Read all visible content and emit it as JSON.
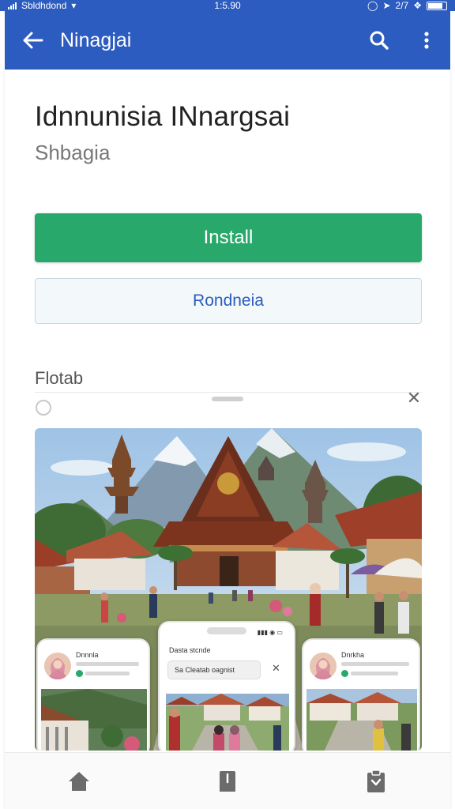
{
  "status_bar": {
    "carrier": "Sbldhdond",
    "time": "1:5.90",
    "right_text": "2/7"
  },
  "app_bar": {
    "title": "Ninagjai",
    "back_icon": "arrow-back-icon",
    "search_icon": "search-icon",
    "more_icon": "more-vert-icon",
    "color": "#2c5cbf"
  },
  "app": {
    "name": "Idnnunisia INnargsai",
    "developer": "Shbagia"
  },
  "buttons": {
    "install_label": "Install",
    "install_color": "#28a96b",
    "secondary_label": "Rondneia"
  },
  "section": {
    "label": "Flotab"
  },
  "screenshot_preview": {
    "phones": [
      {
        "title": "Dnnnla"
      },
      {
        "title": "Dasta stcnde",
        "search": "Sa   Cleatab oagnist"
      },
      {
        "title": "Dnrkha"
      }
    ]
  },
  "bottom_nav": {
    "items": [
      {
        "icon": "home-icon"
      },
      {
        "icon": "bookmark-icon"
      },
      {
        "icon": "clipboard-icon"
      }
    ]
  }
}
